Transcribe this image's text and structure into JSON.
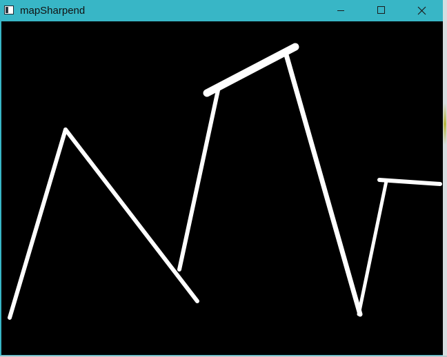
{
  "window": {
    "title": "mapSharpend",
    "controls": {
      "minimize_icon": "minimize-icon",
      "maximize_icon": "maximize-icon",
      "close_icon": "close-icon"
    },
    "titlebar_color": "#38b6c6"
  },
  "image": {
    "description_colors": {
      "background": "#000000",
      "stroke": "#ffffff"
    }
  }
}
